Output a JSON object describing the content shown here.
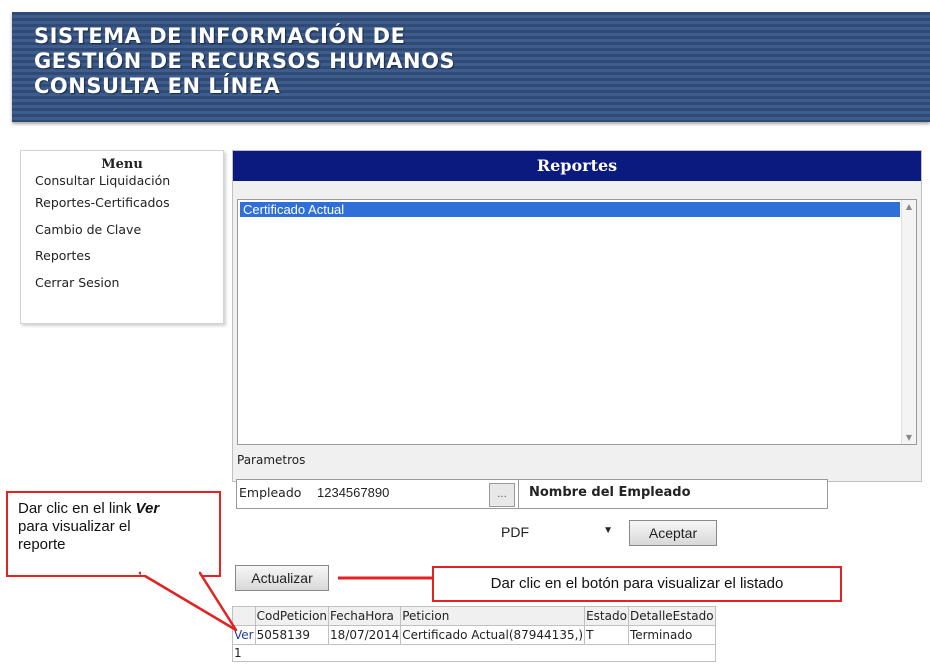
{
  "header": {
    "title_line1": "SISTEMA DE INFORMACIÓN DE",
    "title_line2": "GESTIÓN DE RECURSOS HUMANOS",
    "title_line3": "CONSULTA EN LÍNEA"
  },
  "menu": {
    "title": "Menu",
    "items": [
      {
        "label": "Consultar Liquidación"
      },
      {
        "label": "Reportes-Certificados"
      },
      {
        "label": "Cambio de Clave"
      },
      {
        "label": "Reportes"
      },
      {
        "label": "Cerrar Sesion"
      }
    ]
  },
  "reportes": {
    "title": "Reportes",
    "list_items": [
      "Certificado Actual"
    ],
    "parametros_label": "Parametros",
    "empleado_label": "Empleado",
    "empleado_value": "1234567890",
    "lookup_button": "...",
    "nombre_empleado": "Nombre del Empleado",
    "format_selected": "PDF",
    "aceptar_label": "Aceptar"
  },
  "actualizar_label": "Actualizar",
  "grid": {
    "headers": [
      "",
      "CodPeticion",
      "FechaHora",
      "Peticion",
      "Estado",
      "DetalleEstado"
    ],
    "rows": [
      {
        "link": "Ver",
        "cod": "5058139",
        "fecha": "18/07/2014",
        "peticion": "Certificado Actual(87944135,)",
        "estado": "T",
        "detalle": "Terminado"
      }
    ],
    "pager": "1"
  },
  "callouts": {
    "left_line1": "Dar clic en el link ",
    "left_emphasis": "Ver",
    "left_line2": "para visualizar el",
    "left_line3": "reporte",
    "right": "Dar clic en el botón para visualizar el listado"
  },
  "colors": {
    "banner": "#2f4a75",
    "panel_header": "#0b1a7e",
    "selection": "#2f6fd8",
    "callout_border": "#e32222",
    "link": "#1f3ca6"
  }
}
